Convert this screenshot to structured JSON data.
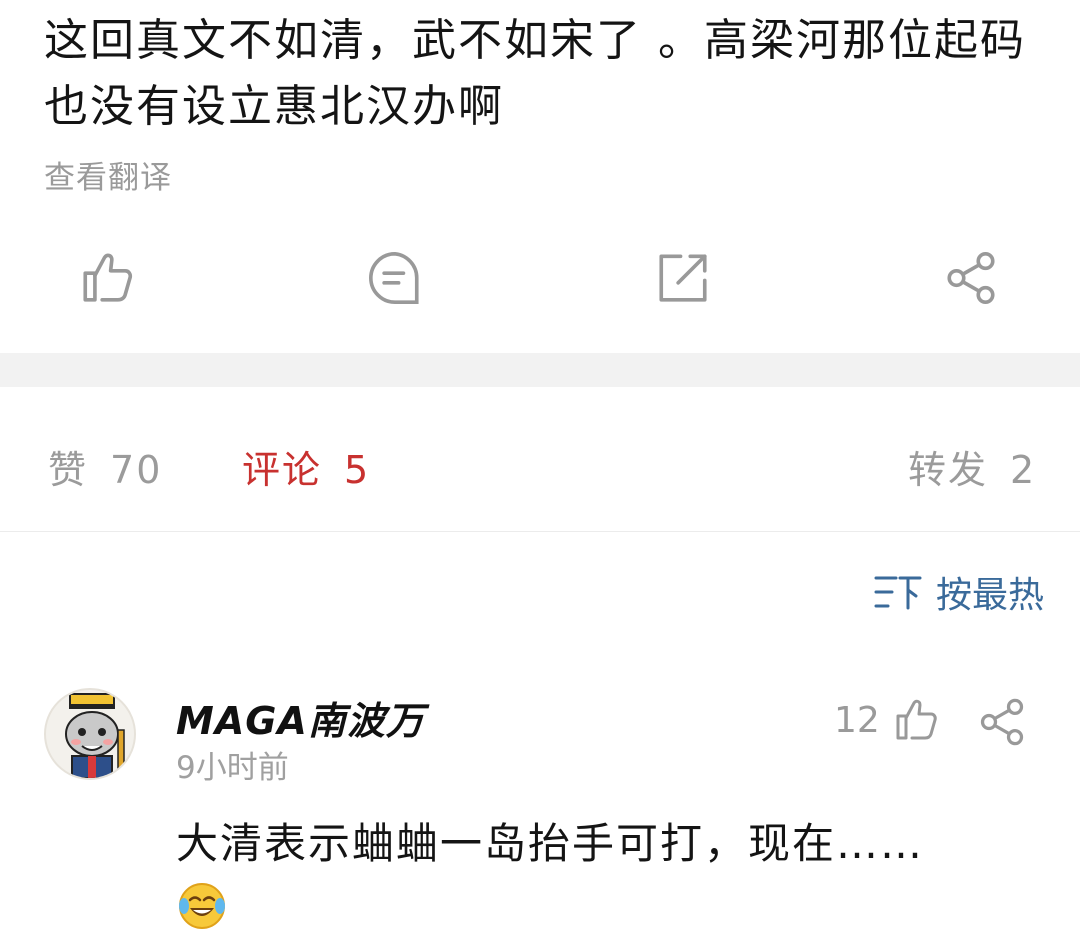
{
  "post": {
    "text": "这回真文不如清，武不如宋了 。高梁河那位起码也没有设立惠北汉办啊",
    "translate_label": "查看翻译"
  },
  "actions": {
    "like_icon": "thumbs-up-icon",
    "comment_icon": "comment-icon",
    "repost_icon": "repost-icon",
    "share_icon": "share-icon"
  },
  "stats": {
    "likes_label": "赞",
    "likes_count": "70",
    "comments_label": "评论",
    "comments_count": "5",
    "reposts_label": "转发",
    "reposts_count": "2"
  },
  "sort": {
    "label": "按最热",
    "icon": "sort-icon"
  },
  "comments": [
    {
      "username": "MAGA南波万",
      "time": "9小时前",
      "likes": "12",
      "text": "大清表示蛐蛐一岛抬手可打，现在……",
      "emoji": "laughing-crying-emoji"
    }
  ],
  "colors": {
    "accent_red": "#c8312f",
    "link_blue": "#3a6a9a",
    "muted_gray": "#9b9b9b"
  }
}
